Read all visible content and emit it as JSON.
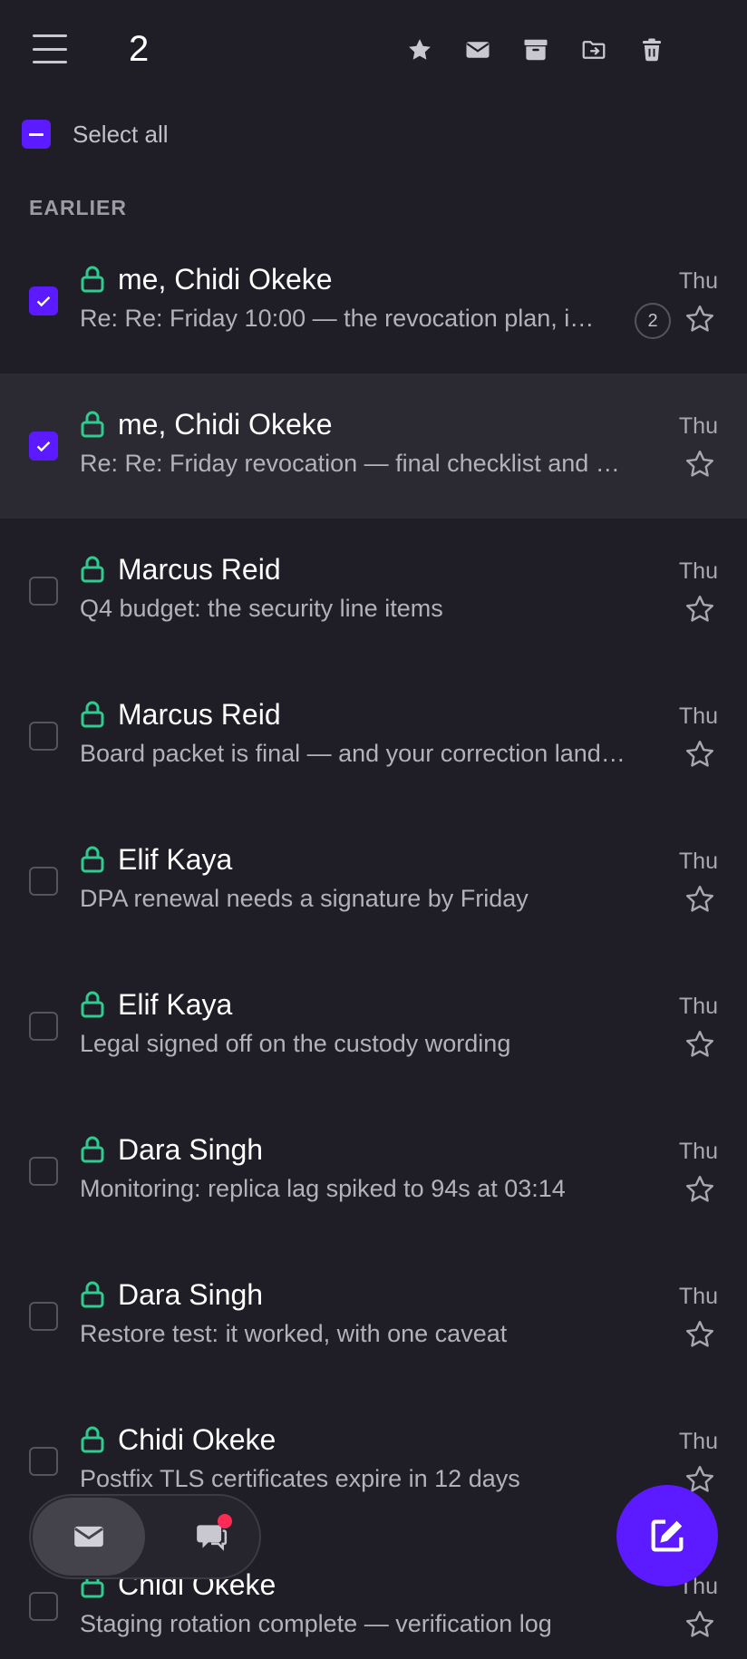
{
  "header": {
    "selected_count": "2"
  },
  "select_all": {
    "label": "Select all"
  },
  "section": {
    "label": "EARLIER"
  },
  "messages": [
    {
      "sender": "me, Chidi Okeke",
      "subject": "Re: Re: Friday 10:00 — the revocation plan, i…",
      "date": "Thu",
      "checked": true,
      "thread_count": "2"
    },
    {
      "sender": "me, Chidi Okeke",
      "subject": "Re: Re: Friday revocation — final checklist and …",
      "date": "Thu",
      "checked": true
    },
    {
      "sender": "Marcus Reid",
      "subject": "Q4 budget: the security line items",
      "date": "Thu",
      "checked": false
    },
    {
      "sender": "Marcus Reid",
      "subject": "Board packet is final — and your correction land…",
      "date": "Thu",
      "checked": false
    },
    {
      "sender": "Elif Kaya",
      "subject": "DPA renewal needs a signature by Friday",
      "date": "Thu",
      "checked": false
    },
    {
      "sender": "Elif Kaya",
      "subject": "Legal signed off on the custody wording",
      "date": "Thu",
      "checked": false
    },
    {
      "sender": "Dara Singh",
      "subject": "Monitoring: replica lag spiked to 94s at 03:14",
      "date": "Thu",
      "checked": false
    },
    {
      "sender": "Dara Singh",
      "subject": "Restore test: it worked, with one caveat",
      "date": "Thu",
      "checked": false
    },
    {
      "sender": "Chidi Okeke",
      "subject": "Postfix TLS certificates expire in 12 days",
      "date": "Thu",
      "checked": false
    },
    {
      "sender": "Chidi Okeke",
      "subject": "Staging rotation complete — verification log",
      "date": "Thu",
      "checked": false
    }
  ],
  "colors": {
    "accent": "#5b1aff",
    "lock": "#2ecc8f",
    "notification": "#ff2a55",
    "background": "#1f1e26"
  },
  "icons": {
    "toolbar": [
      "star-icon",
      "mail-icon",
      "archive-icon",
      "move-to-folder-icon",
      "trash-icon"
    ],
    "nav": [
      "mail-icon",
      "chat-icon"
    ],
    "fab": "compose-icon"
  }
}
